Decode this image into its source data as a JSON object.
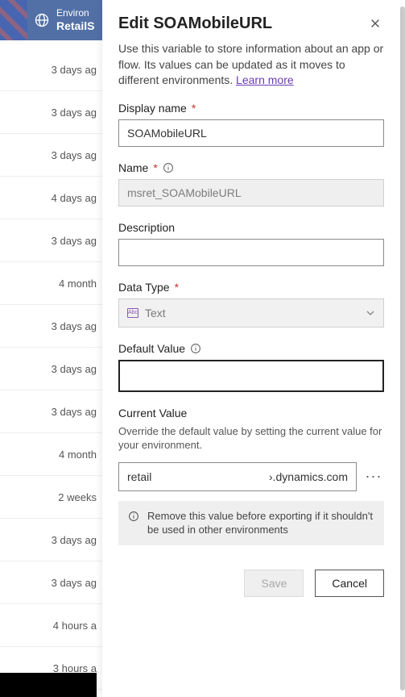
{
  "header": {
    "env_label": "Environ",
    "env_name": "RetailS"
  },
  "bg_list": [
    "3 days ag",
    "3 days ag",
    "3 days ag",
    "4 days ag",
    "3 days ag",
    "4 month",
    "3 days ag",
    "3 days ag",
    "3 days ag",
    "4 month",
    "2 weeks",
    "3 days ag",
    "3 days ag",
    "4 hours a",
    "3 hours a"
  ],
  "panel": {
    "title": "Edit SOAMobileURL",
    "description_text": "Use this variable to store information about an app or flow. Its values can be updated as it moves to different environments. ",
    "learn_more": "Learn more",
    "display_name_label": "Display name",
    "display_name_value": "SOAMobileURL",
    "name_label": "Name",
    "name_value": "msret_SOAMobileURL",
    "description_label": "Description",
    "description_value": "",
    "data_type_label": "Data Type",
    "data_type_value": "Text",
    "default_value_label": "Default Value",
    "default_value_value": "",
    "current_value_label": "Current Value",
    "current_value_desc": "Override the default value by setting the current value for your environment.",
    "current_value_prefix": "retail",
    "current_value_suffix": "›.dynamics.com",
    "warn_text": "Remove this value before exporting if it shouldn't be used in other environments",
    "save_label": "Save",
    "cancel_label": "Cancel",
    "abc_icon_text": "Abc"
  }
}
